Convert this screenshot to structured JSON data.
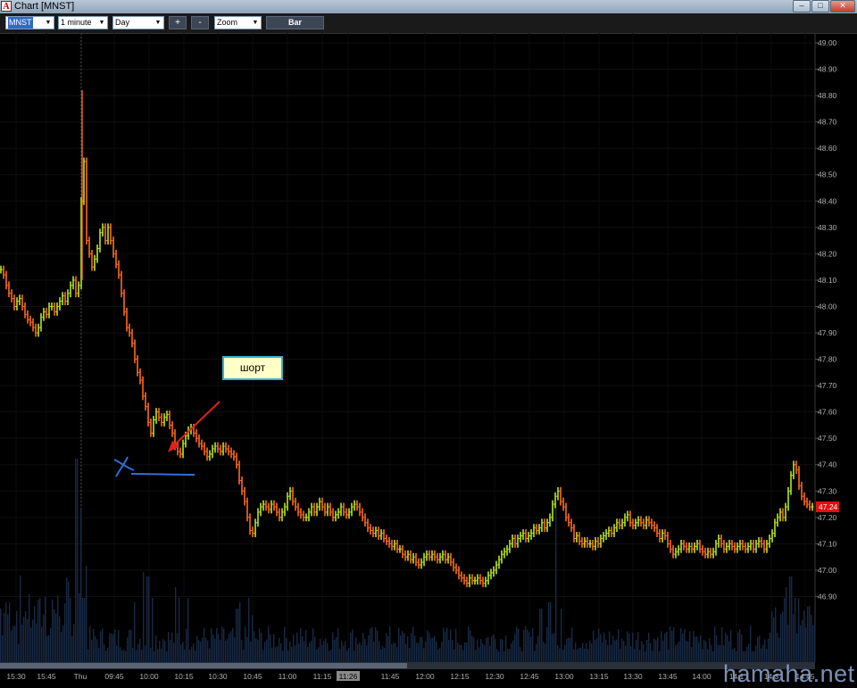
{
  "window": {
    "title": "Chart [MNST]",
    "app_icon_letter": "A"
  },
  "toolbar": {
    "symbol": "MNST",
    "interval": "1 minute",
    "range": "Day",
    "zoom_in": "+",
    "zoom_out": "-",
    "zoom": "Zoom",
    "style": "Bar"
  },
  "annotation": {
    "label": "шорт"
  },
  "watermark": "hamaha.net",
  "colors": {
    "up": "#b5e61d",
    "down": "#ff6a1a",
    "volume": "#172a45",
    "annotation_arrow": "#e0201a",
    "marker": "#2f6fd6",
    "price_tag": "#e01010"
  },
  "chart_data": {
    "type": "bar",
    "title": "",
    "xlabel": "",
    "ylabel": "",
    "ylim": [
      46.8,
      49.0
    ],
    "y_ticks": [
      "49.00",
      "48.90",
      "48.80",
      "48.70",
      "48.60",
      "48.50",
      "48.40",
      "48.30",
      "48.20",
      "48.10",
      "48.00",
      "47.90",
      "47.80",
      "47.70",
      "47.60",
      "47.50",
      "47.40",
      "47.30",
      "47.20",
      "47.10",
      "47.00",
      "46.90"
    ],
    "x_ticks": [
      "15:30",
      "15:45",
      "Thu",
      "09:45",
      "10:00",
      "10:15",
      "10:30",
      "10:45",
      "11:00",
      "11:15",
      "11:26",
      "11:45",
      "12:00",
      "12:15",
      "12:30",
      "12:45",
      "13:00",
      "13:15",
      "13:30",
      "13:45",
      "14:00",
      "14:1",
      "14:3",
      "14:45"
    ],
    "last_price": "47.24",
    "price_path": [
      [
        0,
        48.14
      ],
      [
        3,
        48.12
      ],
      [
        6,
        48.08
      ],
      [
        9,
        48.05
      ],
      [
        12,
        48.03
      ],
      [
        15,
        48.0
      ],
      [
        18,
        48.02
      ],
      [
        21,
        48.03
      ],
      [
        24,
        48.0
      ],
      [
        27,
        47.97
      ],
      [
        30,
        47.95
      ],
      [
        33,
        47.94
      ],
      [
        36,
        47.92
      ],
      [
        39,
        47.9
      ],
      [
        42,
        47.92
      ],
      [
        45,
        47.96
      ],
      [
        48,
        47.98
      ],
      [
        51,
        47.97
      ],
      [
        54,
        48.0
      ],
      [
        57,
        48.0
      ],
      [
        60,
        47.98
      ],
      [
        63,
        48.0
      ],
      [
        66,
        48.02
      ],
      [
        69,
        48.04
      ],
      [
        72,
        48.02
      ],
      [
        75,
        48.05
      ],
      [
        78,
        48.08
      ],
      [
        81,
        48.1
      ],
      [
        84,
        48.05
      ],
      [
        87,
        48.08
      ],
      [
        90,
        48.4
      ],
      [
        93,
        48.55
      ],
      [
        96,
        48.25
      ],
      [
        99,
        48.2
      ],
      [
        102,
        48.15
      ],
      [
        105,
        48.18
      ],
      [
        108,
        48.22
      ],
      [
        111,
        48.28
      ],
      [
        114,
        48.3
      ],
      [
        117,
        48.25
      ],
      [
        120,
        48.3
      ],
      [
        123,
        48.25
      ],
      [
        126,
        48.2
      ],
      [
        129,
        48.16
      ],
      [
        132,
        48.12
      ],
      [
        135,
        48.05
      ],
      [
        138,
        47.98
      ],
      [
        141,
        47.92
      ],
      [
        144,
        47.9
      ],
      [
        147,
        47.86
      ],
      [
        150,
        47.8
      ],
      [
        153,
        47.75
      ],
      [
        156,
        47.72
      ],
      [
        159,
        47.66
      ],
      [
        162,
        47.62
      ],
      [
        165,
        47.56
      ],
      [
        168,
        47.52
      ],
      [
        171,
        47.57
      ],
      [
        174,
        47.6
      ],
      [
        177,
        47.58
      ],
      [
        180,
        47.56
      ],
      [
        183,
        47.58
      ],
      [
        186,
        47.59
      ],
      [
        189,
        47.55
      ],
      [
        192,
        47.52
      ],
      [
        195,
        47.47
      ],
      [
        198,
        47.45
      ],
      [
        201,
        47.44
      ],
      [
        204,
        47.48
      ],
      [
        207,
        47.51
      ],
      [
        210,
        47.53
      ],
      [
        213,
        47.54
      ],
      [
        216,
        47.52
      ],
      [
        219,
        47.5
      ],
      [
        222,
        47.48
      ],
      [
        225,
        47.47
      ],
      [
        228,
        47.45
      ],
      [
        231,
        47.43
      ],
      [
        234,
        47.44
      ],
      [
        237,
        47.46
      ],
      [
        240,
        47.47
      ],
      [
        243,
        47.46
      ],
      [
        246,
        47.45
      ],
      [
        249,
        47.47
      ],
      [
        252,
        47.46
      ],
      [
        255,
        47.45
      ],
      [
        258,
        47.44
      ],
      [
        261,
        47.43
      ],
      [
        264,
        47.4
      ],
      [
        267,
        47.34
      ],
      [
        270,
        47.3
      ],
      [
        273,
        47.26
      ],
      [
        276,
        47.2
      ],
      [
        279,
        47.15
      ],
      [
        282,
        47.14
      ],
      [
        285,
        47.18
      ],
      [
        288,
        47.22
      ],
      [
        291,
        47.24
      ],
      [
        294,
        47.25
      ],
      [
        297,
        47.24
      ],
      [
        300,
        47.23
      ],
      [
        303,
        47.25
      ],
      [
        306,
        47.24
      ],
      [
        309,
        47.22
      ],
      [
        312,
        47.2
      ],
      [
        315,
        47.22
      ],
      [
        318,
        47.24
      ],
      [
        321,
        47.28
      ],
      [
        324,
        47.3
      ],
      [
        327,
        47.26
      ],
      [
        330,
        47.24
      ],
      [
        333,
        47.22
      ],
      [
        336,
        47.21
      ],
      [
        339,
        47.2
      ],
      [
        342,
        47.2
      ],
      [
        345,
        47.22
      ],
      [
        348,
        47.24
      ],
      [
        351,
        47.22
      ],
      [
        354,
        47.24
      ],
      [
        357,
        47.26
      ],
      [
        360,
        47.24
      ],
      [
        363,
        47.22
      ],
      [
        366,
        47.24
      ],
      [
        369,
        47.22
      ],
      [
        372,
        47.2
      ],
      [
        375,
        47.21
      ],
      [
        378,
        47.22
      ],
      [
        381,
        47.24
      ],
      [
        384,
        47.22
      ],
      [
        387,
        47.21
      ],
      [
        390,
        47.22
      ],
      [
        393,
        47.24
      ],
      [
        396,
        47.25
      ],
      [
        399,
        47.24
      ],
      [
        402,
        47.22
      ],
      [
        405,
        47.2
      ],
      [
        408,
        47.18
      ],
      [
        411,
        47.16
      ],
      [
        414,
        47.15
      ],
      [
        417,
        47.14
      ],
      [
        420,
        47.15
      ],
      [
        423,
        47.13
      ],
      [
        426,
        47.14
      ],
      [
        429,
        47.12
      ],
      [
        432,
        47.11
      ],
      [
        435,
        47.1
      ],
      [
        438,
        47.09
      ],
      [
        441,
        47.1
      ],
      [
        444,
        47.08
      ],
      [
        447,
        47.08
      ],
      [
        450,
        47.06
      ],
      [
        453,
        47.05
      ],
      [
        456,
        47.06
      ],
      [
        459,
        47.04
      ],
      [
        462,
        47.05
      ],
      [
        465,
        47.03
      ],
      [
        468,
        47.02
      ],
      [
        471,
        47.03
      ],
      [
        474,
        47.05
      ],
      [
        477,
        47.06
      ],
      [
        480,
        47.05
      ],
      [
        483,
        47.06
      ],
      [
        486,
        47.05
      ],
      [
        489,
        47.04
      ],
      [
        492,
        47.05
      ],
      [
        495,
        47.06
      ],
      [
        498,
        47.04
      ],
      [
        501,
        47.05
      ],
      [
        504,
        47.03
      ],
      [
        507,
        47.01
      ],
      [
        510,
        47.0
      ],
      [
        513,
        46.98
      ],
      [
        516,
        46.97
      ],
      [
        519,
        46.96
      ],
      [
        522,
        46.95
      ],
      [
        525,
        46.97
      ],
      [
        528,
        46.96
      ],
      [
        531,
        46.96
      ],
      [
        534,
        46.97
      ],
      [
        537,
        46.96
      ],
      [
        540,
        46.95
      ],
      [
        543,
        46.96
      ],
      [
        546,
        46.98
      ],
      [
        549,
        46.99
      ],
      [
        552,
        47.0
      ],
      [
        555,
        47.02
      ],
      [
        558,
        47.04
      ],
      [
        561,
        47.06
      ],
      [
        564,
        47.07
      ],
      [
        567,
        47.08
      ],
      [
        570,
        47.1
      ],
      [
        573,
        47.12
      ],
      [
        576,
        47.1
      ],
      [
        579,
        47.12
      ],
      [
        582,
        47.13
      ],
      [
        585,
        47.14
      ],
      [
        588,
        47.12
      ],
      [
        591,
        47.13
      ],
      [
        594,
        47.14
      ],
      [
        597,
        47.16
      ],
      [
        600,
        47.15
      ],
      [
        603,
        47.16
      ],
      [
        606,
        47.18
      ],
      [
        609,
        47.16
      ],
      [
        612,
        47.18
      ],
      [
        615,
        47.2
      ],
      [
        618,
        47.25
      ],
      [
        621,
        47.28
      ],
      [
        624,
        47.3
      ],
      [
        627,
        47.26
      ],
      [
        630,
        47.24
      ],
      [
        633,
        47.2
      ],
      [
        636,
        47.18
      ],
      [
        639,
        47.16
      ],
      [
        642,
        47.12
      ],
      [
        645,
        47.13
      ],
      [
        648,
        47.11
      ],
      [
        651,
        47.1
      ],
      [
        654,
        47.11
      ],
      [
        657,
        47.1
      ],
      [
        660,
        47.1
      ],
      [
        663,
        47.09
      ],
      [
        666,
        47.11
      ],
      [
        669,
        47.1
      ],
      [
        672,
        47.12
      ],
      [
        675,
        47.13
      ],
      [
        678,
        47.14
      ],
      [
        681,
        47.15
      ],
      [
        684,
        47.14
      ],
      [
        687,
        47.16
      ],
      [
        690,
        47.18
      ],
      [
        693,
        47.17
      ],
      [
        696,
        47.18
      ],
      [
        699,
        47.2
      ],
      [
        702,
        47.21
      ],
      [
        705,
        47.18
      ],
      [
        708,
        47.17
      ],
      [
        711,
        47.18
      ],
      [
        714,
        47.19
      ],
      [
        717,
        47.18
      ],
      [
        720,
        47.17
      ],
      [
        723,
        47.19
      ],
      [
        726,
        47.18
      ],
      [
        729,
        47.17
      ],
      [
        732,
        47.16
      ],
      [
        735,
        47.14
      ],
      [
        738,
        47.12
      ],
      [
        741,
        47.14
      ],
      [
        744,
        47.13
      ],
      [
        747,
        47.1
      ],
      [
        750,
        47.08
      ],
      [
        753,
        47.06
      ],
      [
        756,
        47.07
      ],
      [
        759,
        47.08
      ],
      [
        762,
        47.1
      ],
      [
        765,
        47.09
      ],
      [
        768,
        47.08
      ],
      [
        771,
        47.09
      ],
      [
        774,
        47.08
      ],
      [
        777,
        47.09
      ],
      [
        780,
        47.1
      ],
      [
        783,
        47.08
      ],
      [
        786,
        47.07
      ],
      [
        789,
        47.06
      ],
      [
        792,
        47.07
      ],
      [
        795,
        47.06
      ],
      [
        798,
        47.07
      ],
      [
        801,
        47.1
      ],
      [
        804,
        47.12
      ],
      [
        807,
        47.1
      ],
      [
        810,
        47.08
      ],
      [
        813,
        47.09
      ],
      [
        816,
        47.1
      ],
      [
        819,
        47.09
      ],
      [
        822,
        47.08
      ],
      [
        825,
        47.09
      ],
      [
        828,
        47.1
      ],
      [
        831,
        47.09
      ],
      [
        834,
        47.08
      ],
      [
        837,
        47.09
      ],
      [
        840,
        47.1
      ],
      [
        843,
        47.08
      ],
      [
        846,
        47.1
      ],
      [
        849,
        47.11
      ],
      [
        852,
        47.1
      ],
      [
        855,
        47.08
      ],
      [
        858,
        47.1
      ],
      [
        861,
        47.12
      ],
      [
        864,
        47.14
      ],
      [
        867,
        47.18
      ],
      [
        870,
        47.2
      ],
      [
        873,
        47.22
      ],
      [
        876,
        47.2
      ],
      [
        879,
        47.24
      ],
      [
        882,
        47.3
      ],
      [
        885,
        47.36
      ],
      [
        888,
        47.4
      ],
      [
        891,
        47.38
      ],
      [
        894,
        47.32
      ],
      [
        897,
        47.28
      ],
      [
        900,
        47.26
      ],
      [
        903,
        47.25
      ],
      [
        906,
        47.24
      ],
      [
        909,
        47.24
      ]
    ],
    "volume_spikes": [
      [
        85,
        0.95
      ],
      [
        90,
        0.72
      ],
      [
        93,
        0.3
      ],
      [
        96,
        0.45
      ],
      [
        150,
        0.28
      ],
      [
        160,
        0.42
      ],
      [
        165,
        0.4
      ],
      [
        170,
        0.3
      ],
      [
        196,
        0.35
      ],
      [
        200,
        0.3
      ],
      [
        210,
        0.3
      ],
      [
        265,
        0.25
      ],
      [
        268,
        0.28
      ],
      [
        278,
        0.3
      ],
      [
        282,
        0.22
      ],
      [
        605,
        0.25
      ],
      [
        615,
        0.28
      ],
      [
        622,
        0.75
      ],
      [
        628,
        0.25
      ],
      [
        880,
        0.35
      ],
      [
        885,
        0.4
      ],
      [
        890,
        0.3
      ]
    ]
  }
}
